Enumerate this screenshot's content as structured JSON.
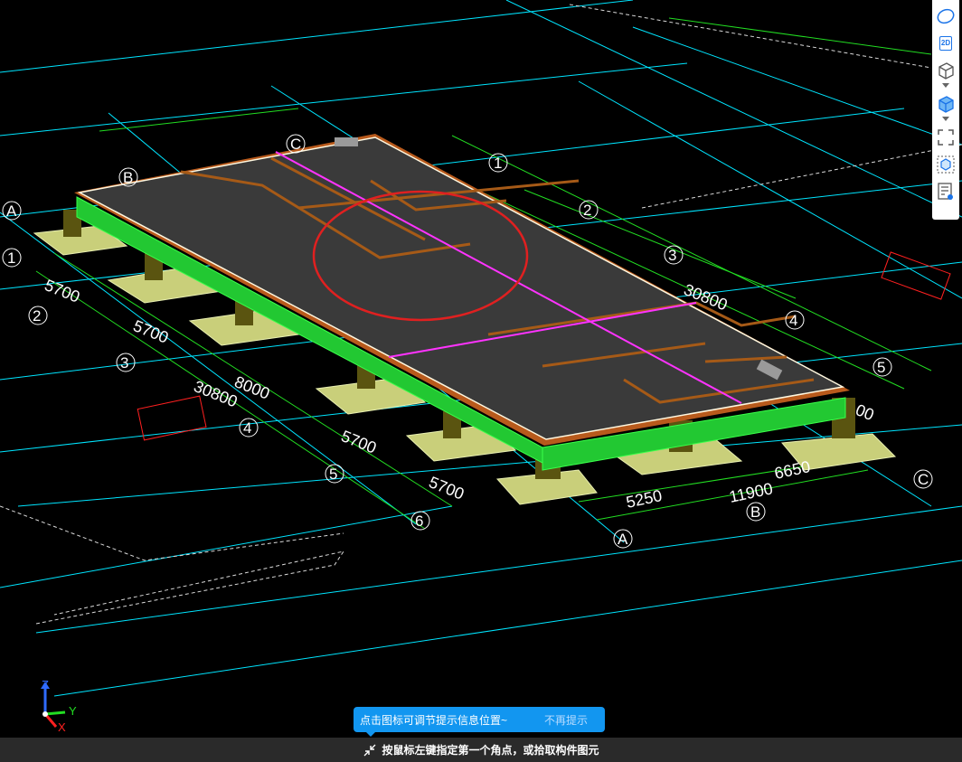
{
  "statusbar": {
    "prompt": "按鼠标左键指定第一个角点，或拾取构件图元",
    "icon": "crosshair-pick-icon"
  },
  "tip": {
    "message": "点击图标可调节提示信息位置~",
    "dismiss": "不再提示"
  },
  "toolbar": {
    "items": [
      {
        "name": "dynamic-observe",
        "icon": "orbit-icon"
      },
      {
        "name": "2d-view",
        "label": "2D",
        "icon": "2d-view-icon"
      },
      {
        "name": "3d-wireframe",
        "icon": "cube-outline-icon"
      },
      {
        "name": "3d-solid",
        "icon": "cube-solid-icon"
      },
      {
        "name": "zoom-extents",
        "icon": "fullscreen-icon"
      },
      {
        "name": "view-cube",
        "icon": "view-cube-icon"
      },
      {
        "name": "display-settings",
        "icon": "list-settings-icon"
      }
    ]
  },
  "gizmo": {
    "z": "Z",
    "y": "Y",
    "x": "X"
  },
  "drawing": {
    "grid_axes_numbers": [
      "1",
      "2",
      "3",
      "4",
      "5",
      "6"
    ],
    "grid_axes_letters": [
      "A",
      "B",
      "C"
    ],
    "dimensions": {
      "left_spans": [
        "5700",
        "5700",
        "8000",
        "5700",
        "5700"
      ],
      "left_total": "30800",
      "right_total": "30800",
      "bottom_spans": [
        "5250",
        "6650"
      ],
      "bottom_total": "11900",
      "right_partial": "00"
    }
  },
  "colors": {
    "background": "#000000",
    "grid_line": "#00e5ff",
    "dimension_line": "#22dd22",
    "slab_top": "#3a3a3a",
    "slab_edge": "#b85a1c",
    "beam_green": "#22c832",
    "footing": "#c9cf7a",
    "column": "#5a5410",
    "highlight_circle": "#e02020",
    "magenta_line": "#ff33ff",
    "tip_bg": "#1296f0",
    "statusbar_bg": "#2a2a2a"
  }
}
